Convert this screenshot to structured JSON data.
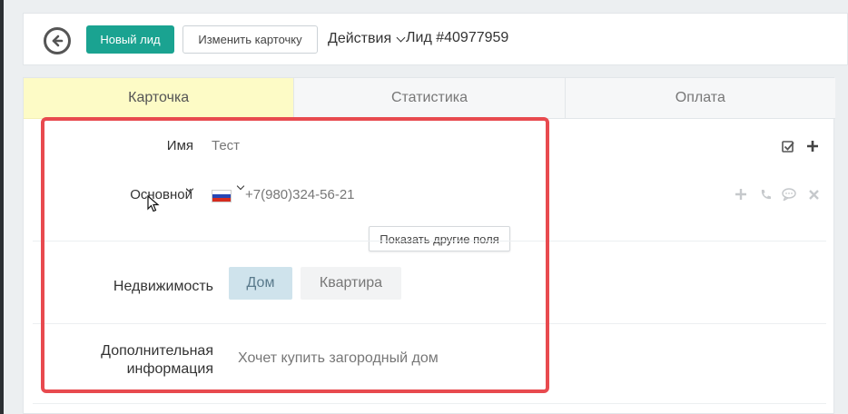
{
  "header": {
    "new_lead_label": "Новый лид",
    "edit_card_label": "Изменить карточку",
    "actions_label": "Действия",
    "lead_id": "Лид #40977959"
  },
  "tabs": [
    {
      "label": "Карточка",
      "active": true
    },
    {
      "label": "Статистика",
      "active": false
    },
    {
      "label": "Оплата",
      "active": false
    }
  ],
  "form": {
    "name_label": "Имя",
    "name_value": "Тест",
    "phone_type_label": "Основной",
    "phone_value": "+7(980)324-56-21",
    "show_more_label": "Показать другие поля",
    "property_label": "Недвижимость",
    "property_options": [
      "Дом",
      "Квартира"
    ],
    "property_selected": "Дом",
    "extra_info_label_line1": "Дополнительная",
    "extra_info_label_line2": "информация",
    "extra_info_value": "Хочет купить загородный дом"
  },
  "colors": {
    "primary_button": "#1aa391",
    "active_tab": "#fdfbc6",
    "highlight_frame": "#e84a4f",
    "selected_segment": "#cfe3ec"
  },
  "icons": {
    "back": "back-arrow-circle-icon",
    "checkbox": "checkbox-icon",
    "plus": "plus-icon",
    "phone": "phone-icon",
    "chat": "chat-icon",
    "close": "close-icon",
    "flag": "russia-flag-icon"
  }
}
